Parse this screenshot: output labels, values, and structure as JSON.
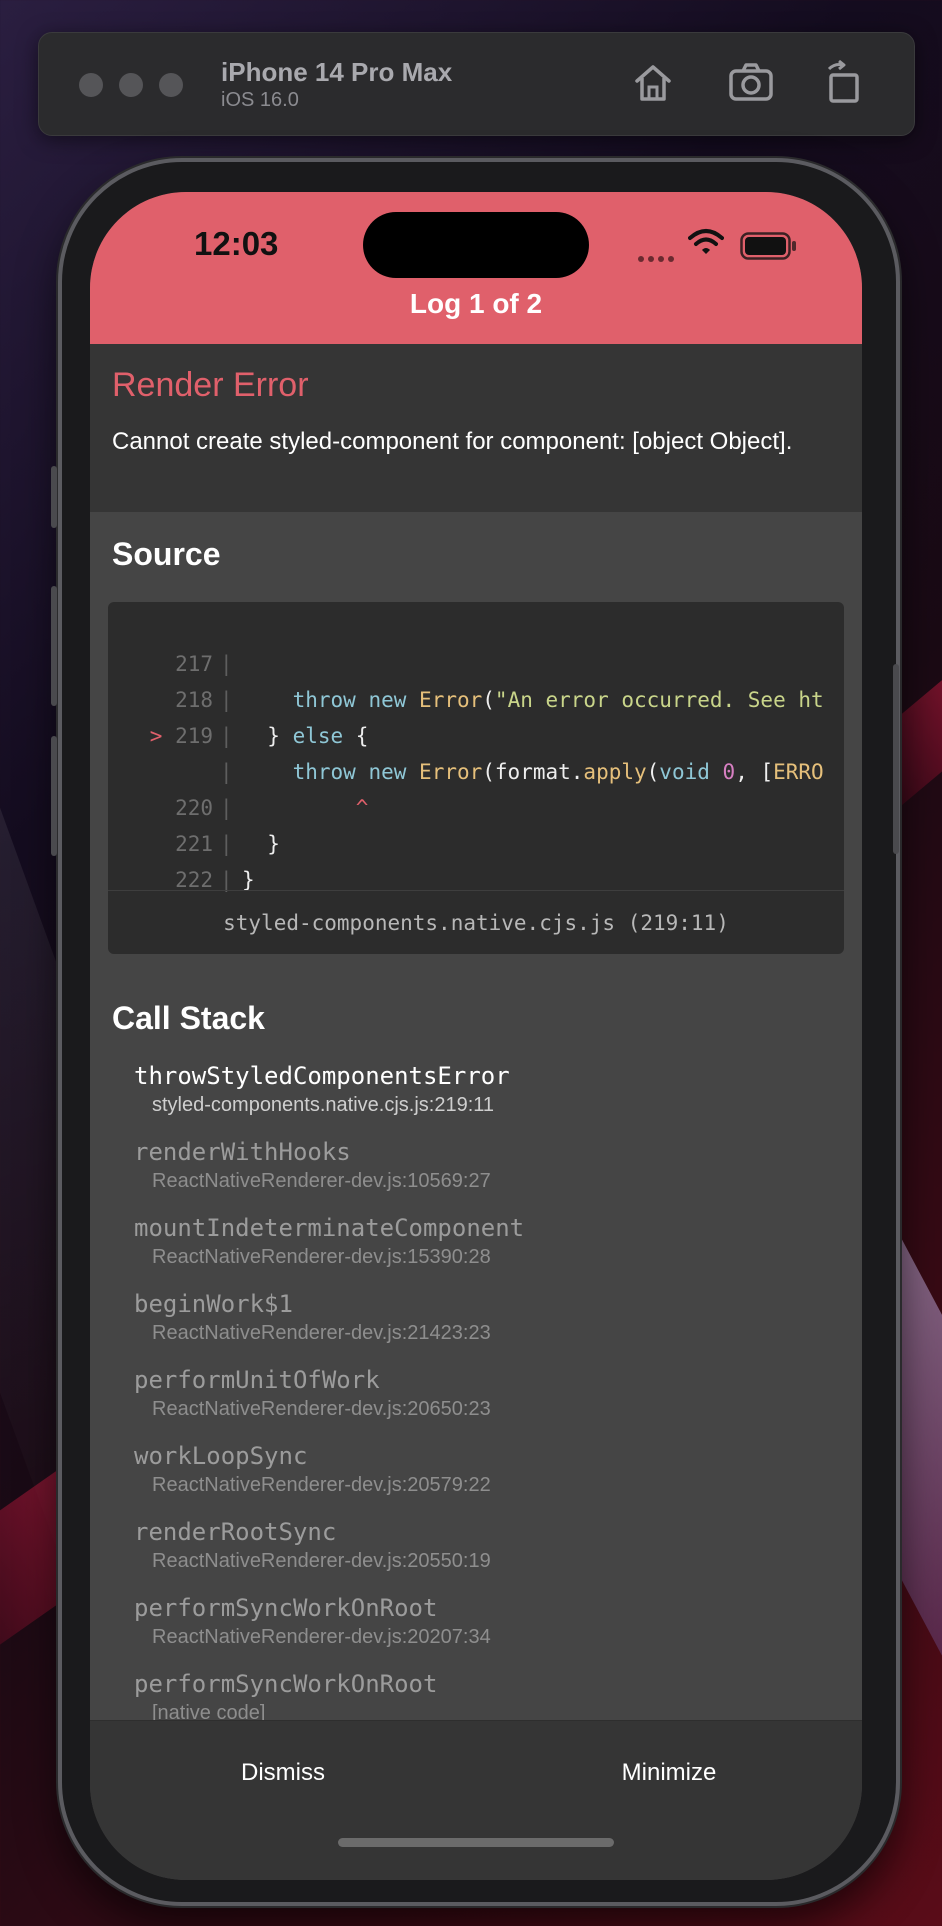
{
  "simulator": {
    "device_name": "iPhone 14 Pro Max",
    "os_version": "iOS 16.0",
    "icons": [
      "home-icon",
      "screenshot-icon",
      "rotate-icon"
    ]
  },
  "status_bar": {
    "time": "12:03"
  },
  "header": {
    "log_title": "Log 1 of 2"
  },
  "error": {
    "title": "Render Error",
    "message": "Cannot create styled-component for component: [object Object]."
  },
  "source": {
    "title": "Source",
    "lines": [
      {
        "num": "217",
        "text": "    throw new Error(\"An error occurred. See ht"
      },
      {
        "num": "218",
        "text": "  } else {"
      },
      {
        "num": "219",
        "marker": ">",
        "text": "    throw new Error(format.apply(void 0, [ERRO"
      },
      {
        "num": "",
        "text": "         ^"
      },
      {
        "num": "220",
        "text": "  }"
      },
      {
        "num": "221",
        "text": "}"
      },
      {
        "num": "222",
        "text": ""
      }
    ],
    "file": "styled-components.native.cjs.js (219:11)"
  },
  "call_stack": {
    "title": "Call Stack",
    "frames": [
      {
        "name": "throwStyledComponentsError",
        "location": "styled-components.native.cjs.js:219:11"
      },
      {
        "name": "renderWithHooks",
        "location": "ReactNativeRenderer-dev.js:10569:27"
      },
      {
        "name": "mountIndeterminateComponent",
        "location": "ReactNativeRenderer-dev.js:15390:28"
      },
      {
        "name": "beginWork$1",
        "location": "ReactNativeRenderer-dev.js:21423:23"
      },
      {
        "name": "performUnitOfWork",
        "location": "ReactNativeRenderer-dev.js:20650:23"
      },
      {
        "name": "workLoopSync",
        "location": "ReactNativeRenderer-dev.js:20579:22"
      },
      {
        "name": "renderRootSync",
        "location": "ReactNativeRenderer-dev.js:20550:19"
      },
      {
        "name": "performSyncWorkOnRoot",
        "location": "ReactNativeRenderer-dev.js:20207:34"
      },
      {
        "name": "performSyncWorkOnRoot",
        "location": "[native code]"
      }
    ]
  },
  "footer": {
    "dismiss_label": "Dismiss",
    "minimize_label": "Minimize"
  },
  "colors": {
    "accent": "#e0606b",
    "panel": "#353535",
    "background": "#454545"
  }
}
